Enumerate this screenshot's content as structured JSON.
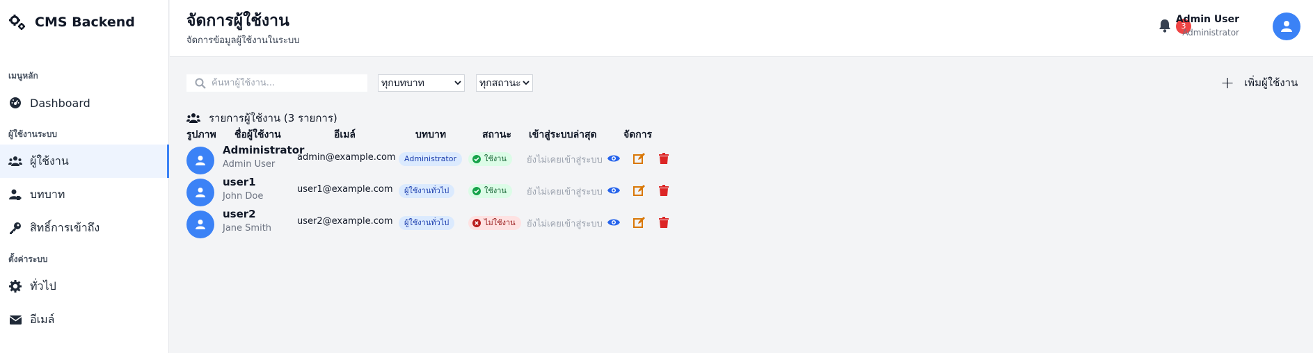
{
  "brand": {
    "title": "CMS Backend",
    "icon": "cogs-icon"
  },
  "sidebar": {
    "sections": [
      {
        "label": "เมนูหลัก",
        "items": [
          {
            "label": "Dashboard",
            "icon": "dashboard-icon"
          }
        ]
      },
      {
        "label": "ผู้ใช้งานระบบ",
        "items": [
          {
            "label": "ผู้ใช้งาน",
            "icon": "users-icon",
            "active": true
          },
          {
            "label": "บทบาท",
            "icon": "user-tag-icon"
          },
          {
            "label": "สิทธิ์การเข้าถึง",
            "icon": "key-icon"
          }
        ]
      },
      {
        "label": "ตั้งค่าระบบ",
        "items": [
          {
            "label": "ทั่วไป",
            "icon": "gear-icon"
          },
          {
            "label": "อีเมล์",
            "icon": "envelope-icon"
          }
        ]
      }
    ]
  },
  "header": {
    "title": "จัดการผู้ใช้งาน",
    "subtitle": "จัดการข้อมูลผู้ใช้งานในระบบ",
    "notification_count": "3",
    "user_name": "Admin User",
    "user_role": "Administrator"
  },
  "toolbar": {
    "search_placeholder": "ค้นหาผู้ใช้งาน...",
    "role_filter": "ทุกบทบาท",
    "status_filter": "ทุกสถานะ",
    "add_label": "เพิ่มผู้ใช้งาน"
  },
  "list": {
    "title": "รายการผู้ใช้งาน (3 รายการ)",
    "columns": [
      "รูปภาพ",
      "ชื่อผู้ใช้งาน",
      "อีเมล์",
      "บทบาท",
      "สถานะ",
      "เข้าสู่ระบบล่าสุด",
      "จัดการ"
    ],
    "rows": [
      {
        "username": "Administrator",
        "fullname": "Admin User",
        "email": "admin@example.com",
        "role": "Administrator",
        "status": "ใช้งาน",
        "active": true,
        "last_login": "ยังไม่เคยเข้าสู่ระบบ"
      },
      {
        "username": "user1",
        "fullname": "John Doe",
        "email": "user1@example.com",
        "role": "ผู้ใช้งานทั่วไป",
        "status": "ใช้งาน",
        "active": true,
        "last_login": "ยังไม่เคยเข้าสู่ระบบ"
      },
      {
        "username": "user2",
        "fullname": "Jane Smith",
        "email": "user2@example.com",
        "role": "ผู้ใช้งานทั่วไป",
        "status": "ไม่ใช้งาน",
        "active": false,
        "last_login": "ยังไม่เคยเข้าสู่ระบบ"
      }
    ]
  },
  "colors": {
    "accent": "#3b82f6",
    "danger": "#dc2626",
    "edit": "#d97706",
    "view": "#2563eb"
  }
}
